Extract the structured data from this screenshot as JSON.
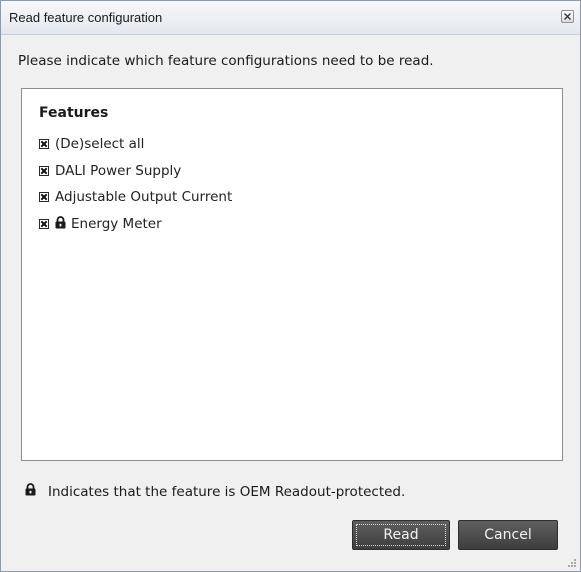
{
  "window": {
    "title": "Read feature configuration"
  },
  "instruction": "Please indicate which feature configurations need to be read.",
  "features": {
    "heading": "Features",
    "items": [
      {
        "label": "(De)select all",
        "checked": true,
        "locked": false
      },
      {
        "label": "DALI Power Supply",
        "checked": true,
        "locked": false
      },
      {
        "label": "Adjustable Output Current",
        "checked": true,
        "locked": false
      },
      {
        "label": "Energy Meter",
        "checked": true,
        "locked": true
      }
    ]
  },
  "legend": {
    "icon": "lock-icon",
    "text": "Indicates that the feature is OEM Readout-protected."
  },
  "buttons": {
    "read_label": "Read",
    "cancel_label": "Cancel"
  },
  "colors": {
    "button_bg": "#4a4a4a",
    "button_text": "#f2f2f2",
    "dialog_bg": "#f0f0f0"
  }
}
